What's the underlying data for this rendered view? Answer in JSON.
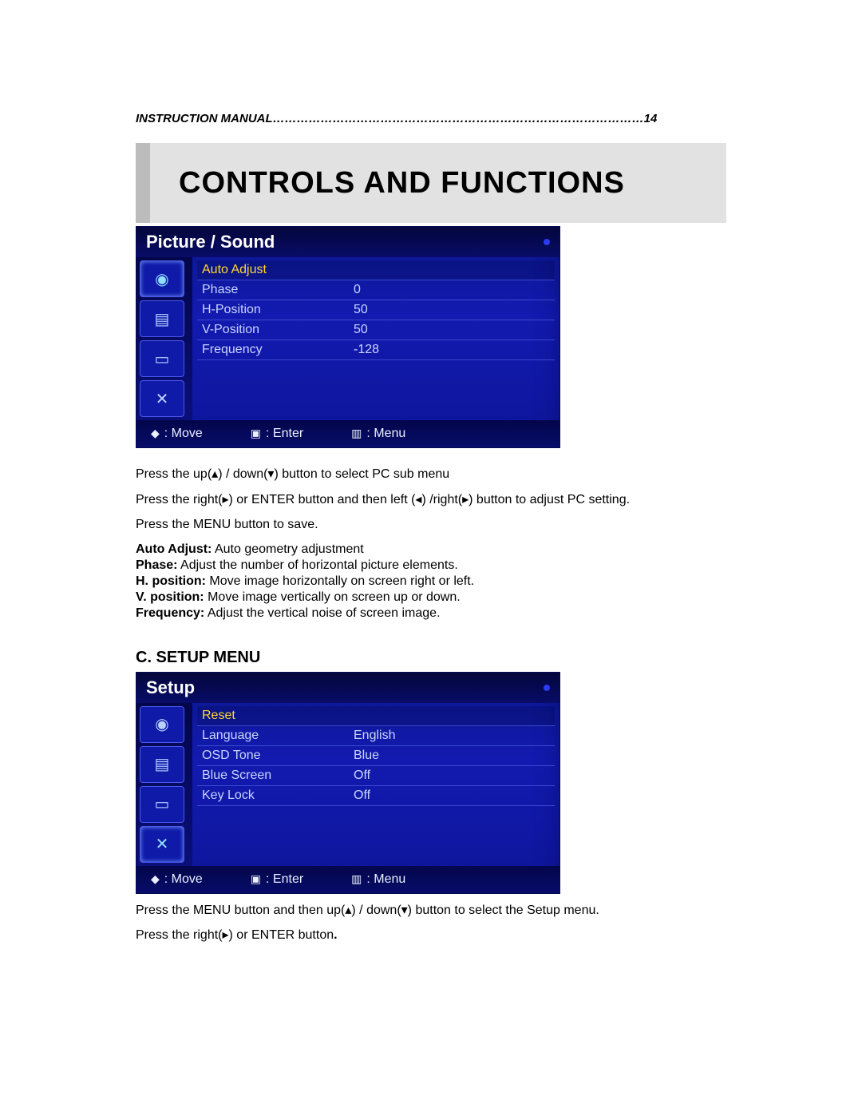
{
  "header": {
    "label": "INSTRUCTION MANUAL",
    "dots": "…………………………………………………………………………………",
    "page": "14"
  },
  "banner_title": "CONTROLS AND FUNCTIONS",
  "osd1": {
    "title": "Picture / Sound",
    "rows": [
      {
        "label": "Auto Adjust",
        "value": "",
        "selected": true
      },
      {
        "label": "Phase",
        "value": "0"
      },
      {
        "label": "H-Position",
        "value": "50"
      },
      {
        "label": "V-Position",
        "value": "50"
      },
      {
        "label": "Frequency",
        "value": "-128"
      }
    ],
    "footer": {
      "move": ": Move",
      "enter": ": Enter",
      "menu": ": Menu"
    }
  },
  "instr1": {
    "p1": "Press the up(▴) / down(▾) button to select PC sub menu",
    "p2": "Press the right(▸) or ENTER button and then left (◂) /right(▸) button to adjust PC setting.",
    "p3": "Press the MENU button to save."
  },
  "defs1": [
    {
      "term": "Auto Adjust:",
      "desc": " Auto geometry adjustment"
    },
    {
      "term": "Phase:",
      "desc": " Adjust the number of horizontal picture elements."
    },
    {
      "term": "H. position:",
      "desc": " Move image horizontally on screen right or left."
    },
    {
      "term": "V. position:",
      "desc": " Move image vertically on screen up or down."
    },
    {
      "term": "Frequency:",
      "desc": " Adjust the vertical noise of screen image."
    }
  ],
  "section_c": "C. SETUP MENU",
  "osd2": {
    "title": "Setup",
    "rows": [
      {
        "label": "Reset",
        "value": "",
        "selected": true
      },
      {
        "label": "Language",
        "value": "English"
      },
      {
        "label": "OSD Tone",
        "value": "Blue"
      },
      {
        "label": "Blue Screen",
        "value": "Off"
      },
      {
        "label": "Key Lock",
        "value": "Off"
      }
    ],
    "footer": {
      "move": ": Move",
      "enter": ": Enter",
      "menu": ": Menu"
    }
  },
  "instr2": {
    "p1": "Press the MENU button and then up(▴) / down(▾) button to select the Setup menu.",
    "p2_pre": "Press the right(▸) or ENTER button",
    "p2_suf": "."
  }
}
